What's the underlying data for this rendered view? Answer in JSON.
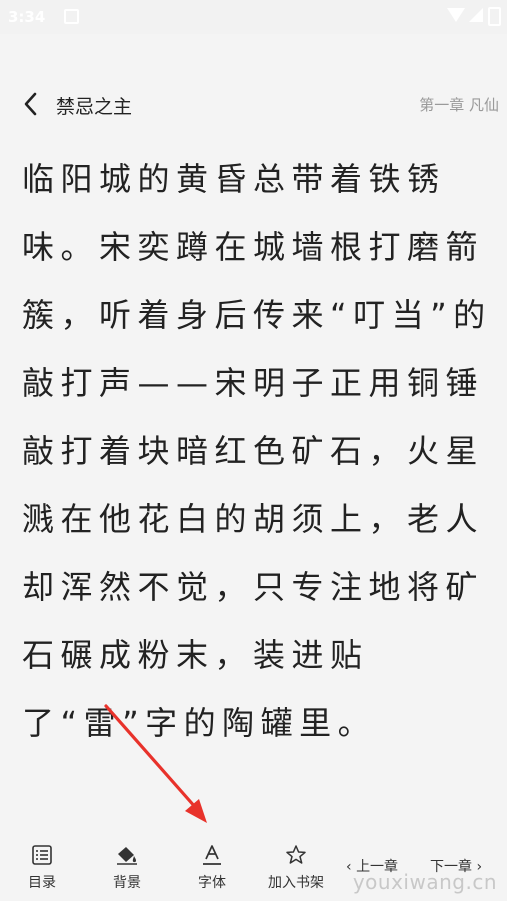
{
  "status_bar": {
    "time": "3:34"
  },
  "header": {
    "book_title": "禁忌之主",
    "chapter_title": "第一章 凡仙"
  },
  "content": {
    "paragraphs": [
      "临阳城的黄昏总带着铁锈味。宋奕蹲在城墙根打磨箭簇，听着身后传来“叮当”的敲打声——宋明子正用铜锤敲打着块暗红色矿石，火星溅在他花白的胡须上，老人却浑然不觉，只专注地将矿石碾成粉末，装进贴了“雷”字的陶罐里。"
    ]
  },
  "toolbar": {
    "items": [
      {
        "label": "目录",
        "icon": "catalog-icon"
      },
      {
        "label": "背景",
        "icon": "paint-bucket-icon"
      },
      {
        "label": "字体",
        "icon": "font-icon"
      },
      {
        "label": "加入书架",
        "icon": "star-icon"
      }
    ],
    "prev_label": "上一章",
    "next_label": "下一章"
  },
  "watermark": "youxiwang.cn",
  "colors": {
    "annotation_arrow": "#e8322b",
    "background": "#f4f4f4"
  }
}
